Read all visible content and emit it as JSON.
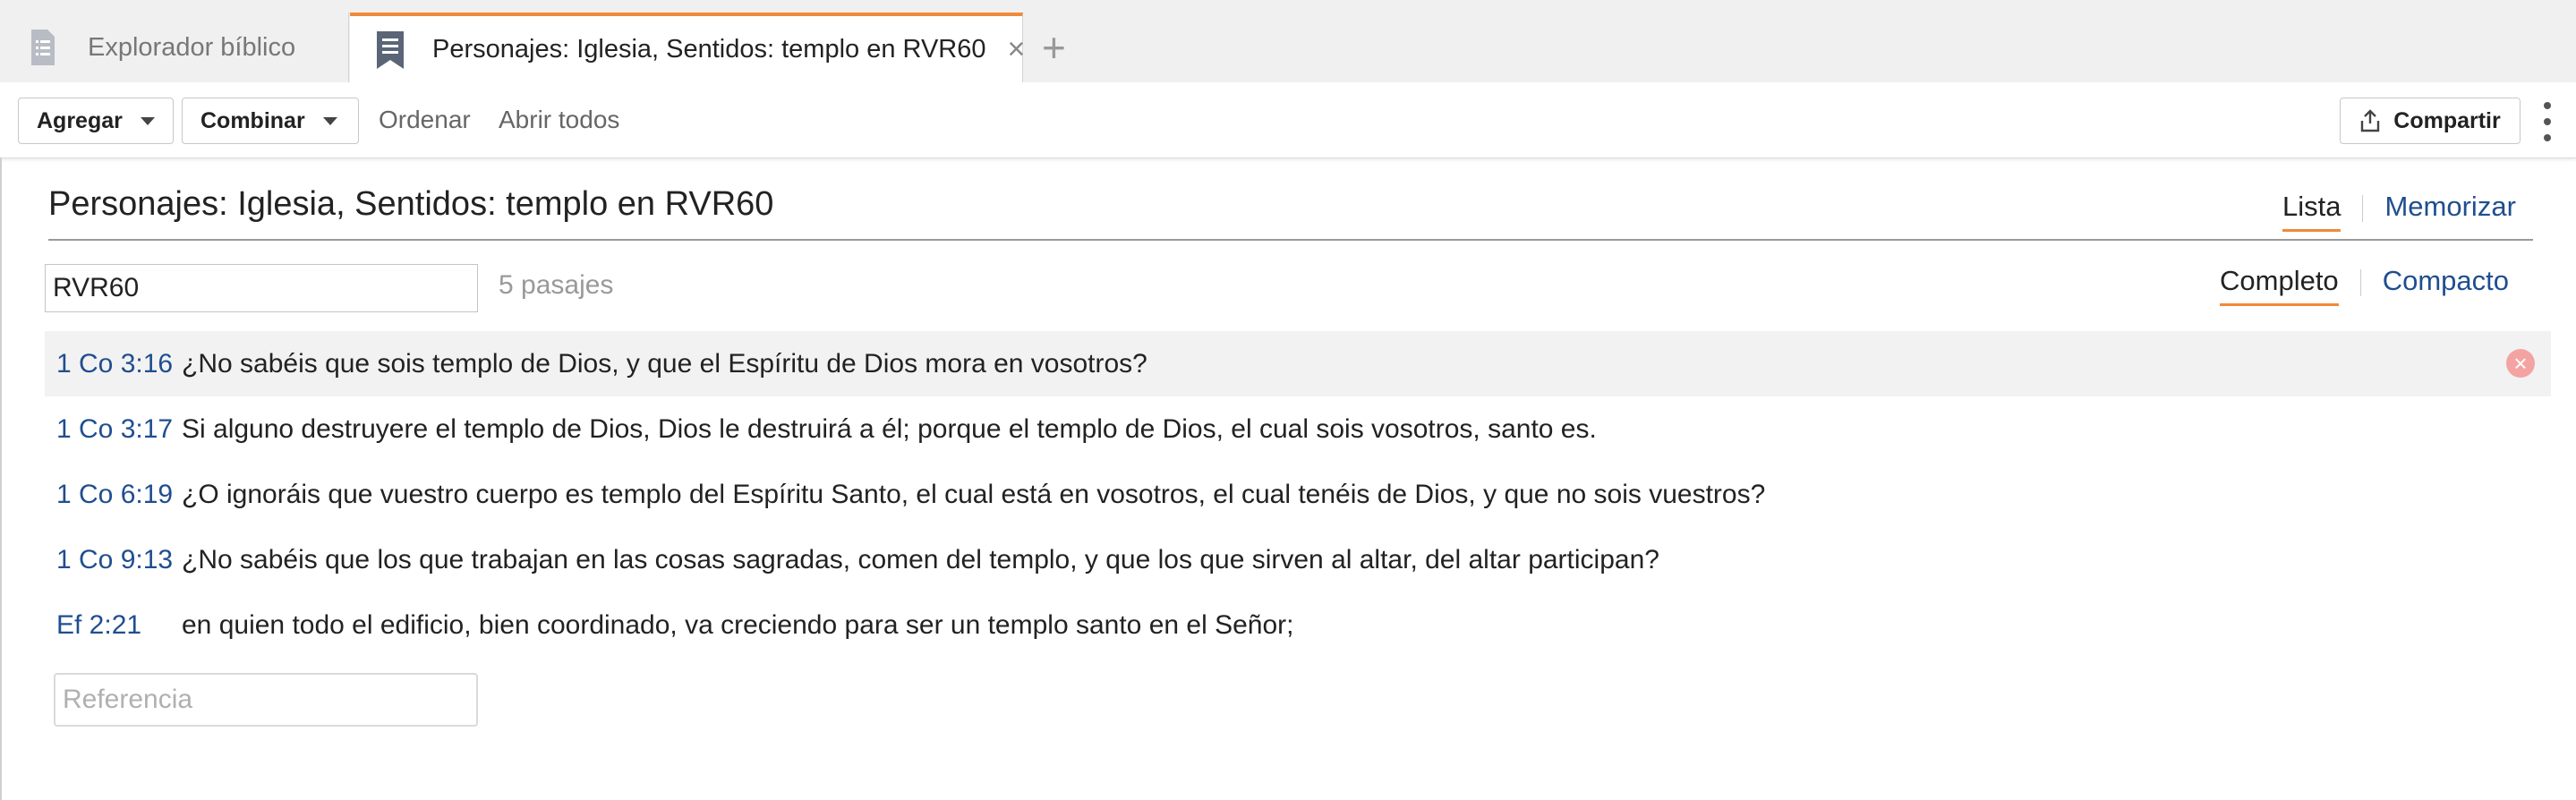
{
  "tabs": [
    {
      "label": "Explorador bíblico",
      "icon": "document-list-icon"
    },
    {
      "label": "Personajes: Iglesia, Sentidos: templo en RVR60",
      "icon": "bookmark-list-icon",
      "close": "×"
    }
  ],
  "add_tab": "+",
  "toolbar": {
    "agregar": "Agregar",
    "combinar": "Combinar",
    "ordenar": "Ordenar",
    "abrir_todos": "Abrir todos",
    "compartir": "Compartir"
  },
  "page": {
    "title": "Personajes: Iglesia, Sentidos: templo en RVR60",
    "view_active": "Lista",
    "view_other": "Memorizar",
    "version_value": "RVR60",
    "count": "5 pasajes",
    "density_active": "Completo",
    "density_other": "Compacto",
    "reference_placeholder": "Referencia"
  },
  "passages": [
    {
      "ref": "1 Co 3:16",
      "text": "¿No sabéis que sois templo de Dios, y que el Espíritu de Dios mora en vosotros?"
    },
    {
      "ref": "1 Co 3:17",
      "text": "Si alguno destruyere el templo de Dios, Dios le destruirá a él; porque el templo de Dios, el cual sois vosotros, santo es."
    },
    {
      "ref": "1 Co 6:19",
      "text": "¿O ignoráis que vuestro cuerpo es templo del Espíritu Santo, el cual está en vosotros, el cual tenéis de Dios, y que no sois vuestros?"
    },
    {
      "ref": "1 Co 9:13",
      "text": "¿No sabéis que los que trabajan en las cosas sagradas, comen del templo, y que los que sirven al altar, del altar participan?"
    },
    {
      "ref": "Ef 2:21",
      "text": "en quien todo el edificio, bien coordinado, va creciendo para ser un templo santo en el Señor;"
    }
  ],
  "colors": {
    "accent": "#f08a3a",
    "link": "#1f4e8f",
    "brand": "#0f2a5f"
  }
}
